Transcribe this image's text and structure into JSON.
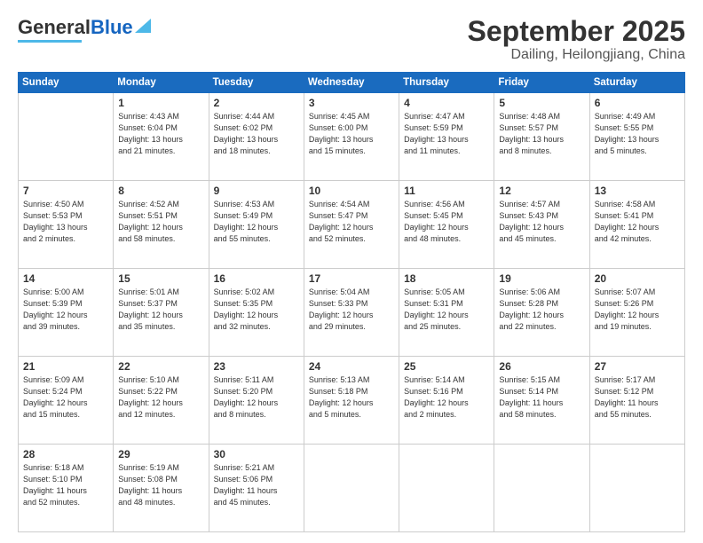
{
  "header": {
    "logo_text1": "General",
    "logo_text2": "Blue",
    "title": "September 2025",
    "subtitle": "Dailing, Heilongjiang, China"
  },
  "calendar": {
    "days_of_week": [
      "Sunday",
      "Monday",
      "Tuesday",
      "Wednesday",
      "Thursday",
      "Friday",
      "Saturday"
    ],
    "weeks": [
      [
        {
          "day": "",
          "info": ""
        },
        {
          "day": "1",
          "info": "Sunrise: 4:43 AM\nSunset: 6:04 PM\nDaylight: 13 hours\nand 21 minutes."
        },
        {
          "day": "2",
          "info": "Sunrise: 4:44 AM\nSunset: 6:02 PM\nDaylight: 13 hours\nand 18 minutes."
        },
        {
          "day": "3",
          "info": "Sunrise: 4:45 AM\nSunset: 6:00 PM\nDaylight: 13 hours\nand 15 minutes."
        },
        {
          "day": "4",
          "info": "Sunrise: 4:47 AM\nSunset: 5:59 PM\nDaylight: 13 hours\nand 11 minutes."
        },
        {
          "day": "5",
          "info": "Sunrise: 4:48 AM\nSunset: 5:57 PM\nDaylight: 13 hours\nand 8 minutes."
        },
        {
          "day": "6",
          "info": "Sunrise: 4:49 AM\nSunset: 5:55 PM\nDaylight: 13 hours\nand 5 minutes."
        }
      ],
      [
        {
          "day": "7",
          "info": "Sunrise: 4:50 AM\nSunset: 5:53 PM\nDaylight: 13 hours\nand 2 minutes."
        },
        {
          "day": "8",
          "info": "Sunrise: 4:52 AM\nSunset: 5:51 PM\nDaylight: 12 hours\nand 58 minutes."
        },
        {
          "day": "9",
          "info": "Sunrise: 4:53 AM\nSunset: 5:49 PM\nDaylight: 12 hours\nand 55 minutes."
        },
        {
          "day": "10",
          "info": "Sunrise: 4:54 AM\nSunset: 5:47 PM\nDaylight: 12 hours\nand 52 minutes."
        },
        {
          "day": "11",
          "info": "Sunrise: 4:56 AM\nSunset: 5:45 PM\nDaylight: 12 hours\nand 48 minutes."
        },
        {
          "day": "12",
          "info": "Sunrise: 4:57 AM\nSunset: 5:43 PM\nDaylight: 12 hours\nand 45 minutes."
        },
        {
          "day": "13",
          "info": "Sunrise: 4:58 AM\nSunset: 5:41 PM\nDaylight: 12 hours\nand 42 minutes."
        }
      ],
      [
        {
          "day": "14",
          "info": "Sunrise: 5:00 AM\nSunset: 5:39 PM\nDaylight: 12 hours\nand 39 minutes."
        },
        {
          "day": "15",
          "info": "Sunrise: 5:01 AM\nSunset: 5:37 PM\nDaylight: 12 hours\nand 35 minutes."
        },
        {
          "day": "16",
          "info": "Sunrise: 5:02 AM\nSunset: 5:35 PM\nDaylight: 12 hours\nand 32 minutes."
        },
        {
          "day": "17",
          "info": "Sunrise: 5:04 AM\nSunset: 5:33 PM\nDaylight: 12 hours\nand 29 minutes."
        },
        {
          "day": "18",
          "info": "Sunrise: 5:05 AM\nSunset: 5:31 PM\nDaylight: 12 hours\nand 25 minutes."
        },
        {
          "day": "19",
          "info": "Sunrise: 5:06 AM\nSunset: 5:28 PM\nDaylight: 12 hours\nand 22 minutes."
        },
        {
          "day": "20",
          "info": "Sunrise: 5:07 AM\nSunset: 5:26 PM\nDaylight: 12 hours\nand 19 minutes."
        }
      ],
      [
        {
          "day": "21",
          "info": "Sunrise: 5:09 AM\nSunset: 5:24 PM\nDaylight: 12 hours\nand 15 minutes."
        },
        {
          "day": "22",
          "info": "Sunrise: 5:10 AM\nSunset: 5:22 PM\nDaylight: 12 hours\nand 12 minutes."
        },
        {
          "day": "23",
          "info": "Sunrise: 5:11 AM\nSunset: 5:20 PM\nDaylight: 12 hours\nand 8 minutes."
        },
        {
          "day": "24",
          "info": "Sunrise: 5:13 AM\nSunset: 5:18 PM\nDaylight: 12 hours\nand 5 minutes."
        },
        {
          "day": "25",
          "info": "Sunrise: 5:14 AM\nSunset: 5:16 PM\nDaylight: 12 hours\nand 2 minutes."
        },
        {
          "day": "26",
          "info": "Sunrise: 5:15 AM\nSunset: 5:14 PM\nDaylight: 11 hours\nand 58 minutes."
        },
        {
          "day": "27",
          "info": "Sunrise: 5:17 AM\nSunset: 5:12 PM\nDaylight: 11 hours\nand 55 minutes."
        }
      ],
      [
        {
          "day": "28",
          "info": "Sunrise: 5:18 AM\nSunset: 5:10 PM\nDaylight: 11 hours\nand 52 minutes."
        },
        {
          "day": "29",
          "info": "Sunrise: 5:19 AM\nSunset: 5:08 PM\nDaylight: 11 hours\nand 48 minutes."
        },
        {
          "day": "30",
          "info": "Sunrise: 5:21 AM\nSunset: 5:06 PM\nDaylight: 11 hours\nand 45 minutes."
        },
        {
          "day": "",
          "info": ""
        },
        {
          "day": "",
          "info": ""
        },
        {
          "day": "",
          "info": ""
        },
        {
          "day": "",
          "info": ""
        }
      ]
    ]
  }
}
